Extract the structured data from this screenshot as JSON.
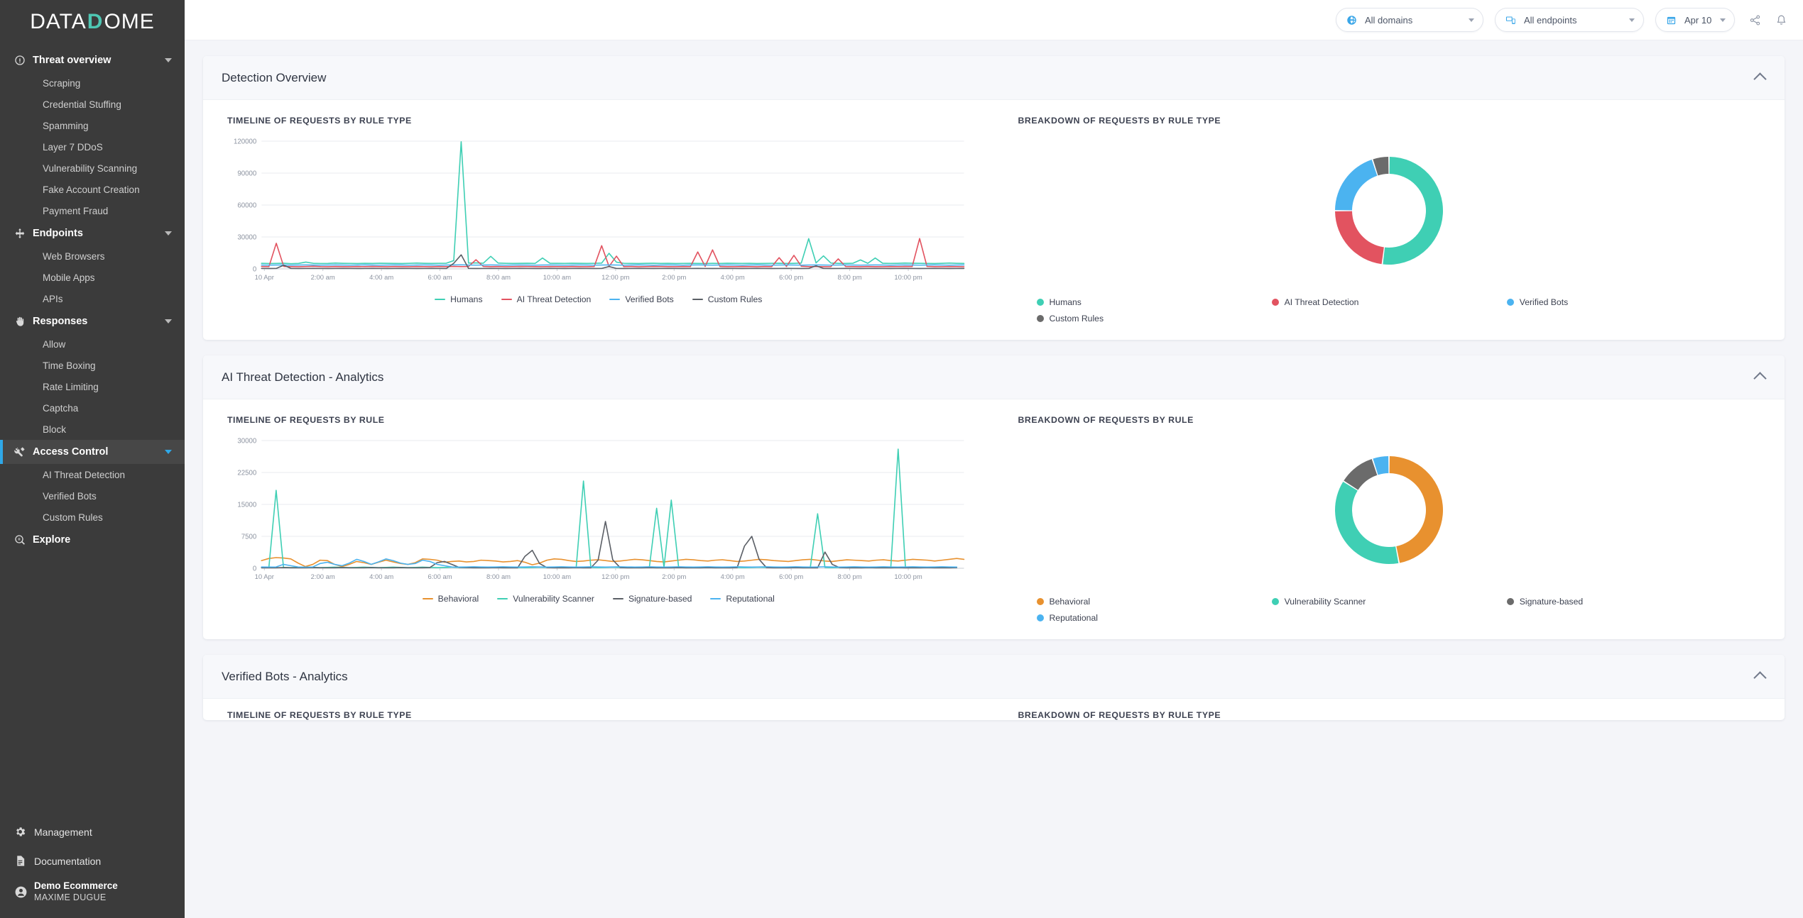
{
  "brand": {
    "name_part1": "DATA",
    "name_d": "D",
    "name_part2": "OME"
  },
  "sidebar": {
    "groups": [
      {
        "label": "Threat overview",
        "icon": "alert-circle-icon",
        "active": false,
        "items": [
          "Scraping",
          "Credential Stuffing",
          "Spamming",
          "Layer 7 DDoS",
          "Vulnerability Scanning",
          "Fake Account Creation",
          "Payment Fraud"
        ]
      },
      {
        "label": "Endpoints",
        "icon": "move-arrows-icon",
        "active": false,
        "items": [
          "Web Browsers",
          "Mobile Apps",
          "APIs"
        ]
      },
      {
        "label": "Responses",
        "icon": "hand-icon",
        "active": false,
        "items": [
          "Allow",
          "Time Boxing",
          "Rate Limiting",
          "Captcha",
          "Block"
        ]
      },
      {
        "label": "Access Control",
        "icon": "tools-icon",
        "active": true,
        "items": [
          "AI Threat Detection",
          "Verified Bots",
          "Custom Rules"
        ]
      },
      {
        "label": "Explore",
        "icon": "explore-icon",
        "active": false,
        "items": []
      }
    ],
    "bottom": [
      {
        "label": "Management",
        "icon": "gear-icon"
      },
      {
        "label": "Documentation",
        "icon": "document-icon"
      }
    ],
    "user": {
      "account": "Demo Ecommerce",
      "name": "MAXIME DUGUE",
      "icon": "user-avatar-icon"
    }
  },
  "topbar": {
    "domains": {
      "label": "All domains",
      "icon": "globe-icon"
    },
    "endpoints": {
      "label": "All endpoints",
      "icon": "devices-icon"
    },
    "date": {
      "label": "Apr 10",
      "icon": "calendar-icon"
    },
    "share_icon": "share-icon",
    "bell_icon": "bell-icon"
  },
  "cards": [
    {
      "title": "Detection Overview",
      "collapse_icon": "chevron-up-icon"
    },
    {
      "title": "AI Threat Detection - Analytics",
      "collapse_icon": "chevron-up-icon"
    },
    {
      "title": "Verified Bots - Analytics",
      "collapse_icon": "chevron-up-icon"
    }
  ],
  "panel_titles": {
    "timeline_rule_type": "TIMELINE OF REQUESTS BY RULE TYPE",
    "breakdown_rule_type": "BREAKDOWN OF REQUESTS BY RULE TYPE",
    "timeline_rule": "TIMELINE OF REQUESTS BY RULE",
    "breakdown_rule": "BREAKDOWN OF REQUESTS BY RULE"
  },
  "colors": {
    "teal": "#3fcfb4",
    "red": "#e25360",
    "blue": "#4bb3f0",
    "dark": "#5b5f66",
    "orange": "#e8912f",
    "gray": "#6b6b6b",
    "accent_blue": "#2fa8e8",
    "sidebar_bg": "#3b3b3b"
  },
  "chart_data": [
    {
      "id": "timeline-rule-type",
      "type": "line",
      "title": "TIMELINE OF REQUESTS BY RULE TYPE",
      "xlabel": "",
      "ylabel": "",
      "ylim": [
        0,
        120000
      ],
      "yticks": [
        0,
        30000,
        60000,
        90000,
        120000
      ],
      "ytick_labels": [
        "0",
        "30000",
        "60000",
        "90000",
        "120000"
      ],
      "xtick_labels": [
        "10 Apr",
        "2:00 am",
        "4:00 am",
        "6:00 am",
        "8:00 am",
        "10:00 am",
        "12:00 pm",
        "2:00 pm",
        "4:00 pm",
        "6:00 pm",
        "8:00 pm",
        "10:00 pm"
      ],
      "grid": true,
      "legend_position": "bottom",
      "series": [
        {
          "name": "Humans",
          "color": "#3fcfb4",
          "values": [
            5200,
            5000,
            5100,
            5300,
            4900,
            5100,
            6400,
            5200,
            5000,
            5100,
            5400,
            5200,
            5100,
            5000,
            5200,
            5100,
            5300,
            5200,
            5100,
            5000,
            5200,
            5400,
            5200,
            5100,
            5200,
            5300,
            7800,
            119500,
            5400,
            5600,
            5300,
            11800,
            5400,
            5200,
            5100,
            5200,
            5300,
            5100,
            10200,
            5300,
            5200,
            5100,
            5300,
            5200,
            5100,
            5200,
            5400,
            14600,
            6300,
            5200,
            5100,
            5000,
            5200,
            5300,
            5100,
            5200,
            5000,
            5100,
            5200,
            5100,
            5000,
            5200,
            5100,
            5300,
            5200,
            5100,
            5200,
            5000,
            5100,
            5200,
            5300,
            5100,
            5200,
            5400,
            28400,
            5600,
            12200,
            5400,
            5200,
            5100,
            5300,
            8400,
            5200,
            10200,
            5300,
            5100,
            5200,
            5400,
            5300,
            5200,
            5100,
            5000,
            5200,
            5400,
            5200,
            5100
          ]
        },
        {
          "name": "AI Threat Detection",
          "color": "#e25360",
          "values": [
            2200,
            2100,
            24100,
            2300,
            2100,
            2000,
            2200,
            2400,
            2100,
            2000,
            2200,
            2100,
            2000,
            2200,
            2100,
            2300,
            2100,
            2000,
            2200,
            2100,
            2000,
            2200,
            2100,
            2000,
            2200,
            2100,
            2300,
            2100,
            2200,
            8600,
            2300,
            2100,
            2200,
            2000,
            2100,
            2300,
            2200,
            2100,
            2000,
            2200,
            2100,
            2000,
            2200,
            2100,
            2000,
            2200,
            21800,
            2300,
            11900,
            2100,
            2200,
            2000,
            2100,
            2300,
            2200,
            2100,
            2000,
            2200,
            2100,
            15900,
            2300,
            17800,
            2200,
            2100,
            2000,
            2200,
            2100,
            2000,
            2200,
            2100,
            10500,
            2300,
            12700,
            2400,
            2100,
            2200,
            2000,
            2100,
            9400,
            2200,
            2100,
            2000,
            2200,
            2100,
            2000,
            2200,
            2100,
            2300,
            2200,
            28500,
            2300,
            2100,
            2000,
            2200,
            2100,
            2000
          ]
        },
        {
          "name": "Verified Bots",
          "color": "#4bb3f0",
          "values": [
            3600,
            3500,
            3600,
            3700,
            3500,
            3600,
            3700,
            3600,
            3500,
            3600,
            3700,
            3600,
            3500,
            3600,
            3700,
            3600,
            3500,
            3600,
            3700,
            3600,
            3500,
            3600,
            3700,
            3600,
            3500,
            3600,
            3700,
            3800,
            3600,
            3500,
            3600,
            3700,
            3600,
            3500,
            3600,
            3700,
            3600,
            3500,
            3600,
            3700,
            3600,
            3500,
            3600,
            3700,
            3600,
            3500,
            3600,
            3700,
            3600,
            3500,
            3600,
            3700,
            3600,
            3500,
            3600,
            3700,
            3600,
            3500,
            3600,
            3700,
            3600,
            3500,
            3600,
            3700,
            3600,
            3500,
            3600,
            3700,
            3600,
            3500,
            3600,
            3700,
            3600,
            3500,
            3600,
            3700,
            3600,
            3500,
            3600,
            3700,
            3600,
            3500,
            3600,
            3700,
            3600,
            3500,
            3600,
            3700,
            3600,
            3500,
            3600,
            3700,
            3600,
            3500,
            3600,
            3700
          ]
        },
        {
          "name": "Custom Rules",
          "color": "#5b5f66",
          "values": [
            400,
            350,
            400,
            3400,
            400,
            350,
            400,
            450,
            400,
            350,
            400,
            450,
            400,
            350,
            400,
            450,
            400,
            350,
            400,
            450,
            400,
            350,
            400,
            450,
            400,
            350,
            5200,
            13200,
            400,
            350,
            400,
            450,
            400,
            350,
            400,
            450,
            400,
            350,
            400,
            450,
            400,
            350,
            400,
            450,
            400,
            350,
            400,
            2200,
            400,
            350,
            400,
            450,
            400,
            350,
            400,
            450,
            400,
            350,
            400,
            450,
            400,
            350,
            400,
            450,
            400,
            350,
            400,
            450,
            400,
            350,
            400,
            450,
            400,
            350,
            400,
            2800,
            400,
            350,
            400,
            450,
            400,
            350,
            400,
            450,
            400,
            350,
            400,
            450,
            400,
            350,
            400,
            450,
            400,
            350,
            400,
            450
          ]
        }
      ]
    },
    {
      "id": "breakdown-rule-type",
      "type": "pie",
      "title": "BREAKDOWN OF REQUESTS BY RULE TYPE",
      "donut": true,
      "legend_position": "bottom",
      "labels": [
        "Humans",
        "AI Threat Detection",
        "Verified Bots",
        "Custom Rules"
      ],
      "values": [
        52,
        23,
        20,
        5
      ],
      "colors": [
        "#3fcfb4",
        "#e25360",
        "#4bb3f0",
        "#6b6b6b"
      ]
    },
    {
      "id": "timeline-rule",
      "type": "line",
      "title": "TIMELINE OF REQUESTS BY RULE",
      "xlabel": "",
      "ylabel": "",
      "ylim": [
        0,
        30000
      ],
      "yticks": [
        0,
        7500,
        15000,
        22500,
        30000
      ],
      "ytick_labels": [
        "0",
        "7500",
        "15000",
        "22500",
        "30000"
      ],
      "xtick_labels": [
        "10 Apr",
        "2:00 am",
        "4:00 am",
        "6:00 am",
        "8:00 am",
        "10:00 am",
        "12:00 pm",
        "2:00 pm",
        "4:00 pm",
        "6:00 pm",
        "8:00 pm",
        "10:00 pm"
      ],
      "grid": true,
      "legend_position": "bottom",
      "series": [
        {
          "name": "Behavioral",
          "color": "#e8912f",
          "values": [
            1800,
            2300,
            2500,
            2400,
            2200,
            1200,
            400,
            900,
            1900,
            1800,
            900,
            400,
            900,
            1600,
            1300,
            900,
            1400,
            1900,
            1500,
            1100,
            900,
            1300,
            2200,
            2100,
            1900,
            1400,
            1600,
            1700,
            1500,
            1600,
            1900,
            1800,
            1700,
            1500,
            1600,
            1800,
            1400,
            800,
            1200,
            1900,
            2200,
            2100,
            1800,
            1600,
            1700,
            1900,
            2000,
            1800,
            1600,
            1700,
            1900,
            2100,
            2000,
            1800,
            1600,
            1500,
            1700,
            1900,
            2100,
            2000,
            1800,
            1700,
            1900,
            2000,
            1800,
            1600,
            1700,
            1900,
            2100,
            2000,
            1800,
            1700,
            1600,
            1800,
            2000,
            2100,
            1900,
            1700,
            1600,
            1800,
            2000,
            1900,
            1800,
            1700,
            1900,
            2000,
            1800,
            1700,
            1900,
            2100,
            2000,
            1900,
            1700,
            1900,
            2100,
            2300,
            2100
          ]
        },
        {
          "name": "Vulnerability Scanner",
          "color": "#3fcfb4",
          "values": [
            200,
            150,
            18300,
            200,
            150,
            200,
            250,
            200,
            150,
            200,
            250,
            200,
            150,
            200,
            250,
            200,
            150,
            200,
            250,
            200,
            150,
            200,
            250,
            200,
            150,
            200,
            250,
            200,
            150,
            200,
            250,
            200,
            150,
            200,
            250,
            200,
            150,
            200,
            250,
            200,
            150,
            200,
            250,
            200,
            20500,
            200,
            150,
            200,
            250,
            200,
            150,
            200,
            250,
            200,
            14100,
            200,
            16000,
            200,
            150,
            200,
            250,
            200,
            150,
            200,
            250,
            200,
            150,
            200,
            250,
            200,
            150,
            200,
            250,
            200,
            150,
            200,
            12800,
            200,
            150,
            200,
            250,
            200,
            150,
            200,
            250,
            200,
            150,
            28000,
            200,
            150,
            200,
            250,
            200,
            150,
            200,
            250
          ]
        },
        {
          "name": "Signature-based",
          "color": "#5b5f66",
          "values": [
            120,
            100,
            120,
            150,
            120,
            100,
            120,
            150,
            120,
            100,
            120,
            150,
            120,
            100,
            120,
            150,
            120,
            100,
            120,
            150,
            120,
            100,
            120,
            150,
            1300,
            1600,
            900,
            200,
            150,
            120,
            100,
            120,
            150,
            120,
            100,
            120,
            2800,
            4200,
            1100,
            150,
            120,
            100,
            120,
            150,
            120,
            100,
            1900,
            11000,
            2000,
            150,
            120,
            100,
            120,
            150,
            120,
            100,
            120,
            150,
            120,
            100,
            120,
            150,
            120,
            100,
            120,
            150,
            5200,
            7500,
            2100,
            150,
            120,
            100,
            120,
            150,
            120,
            100,
            120,
            3800,
            900,
            150,
            120,
            100,
            120,
            150,
            120,
            100,
            120,
            150,
            120,
            100,
            120,
            150,
            120,
            100,
            120,
            150
          ]
        },
        {
          "name": "Reputational",
          "color": "#4bb3f0",
          "values": [
            300,
            280,
            300,
            900,
            600,
            300,
            280,
            300,
            1100,
            1400,
            900,
            600,
            1200,
            2100,
            1600,
            900,
            1500,
            2200,
            1800,
            1200,
            900,
            1100,
            1900,
            1600,
            900,
            600,
            300,
            280,
            300,
            350,
            300,
            280,
            300,
            350,
            300,
            280,
            300,
            350,
            300,
            280,
            300,
            350,
            300,
            280,
            300,
            350,
            300,
            280,
            300,
            350,
            300,
            280,
            300,
            350,
            300,
            280,
            300,
            350,
            300,
            280,
            300,
            350,
            300,
            280,
            300,
            350,
            300,
            280,
            300,
            350,
            300,
            280,
            300,
            350,
            300,
            280,
            300,
            350,
            300,
            280,
            300,
            350,
            300,
            280,
            300,
            350,
            300,
            280,
            300,
            350,
            300,
            280,
            300,
            350,
            300,
            280
          ]
        }
      ]
    },
    {
      "id": "breakdown-rule",
      "type": "pie",
      "title": "BREAKDOWN OF REQUESTS BY RULE",
      "donut": true,
      "legend_position": "bottom",
      "labels": [
        "Behavioral",
        "Vulnerability Scanner",
        "Signature-based",
        "Reputational"
      ],
      "values": [
        47,
        37,
        11,
        5
      ],
      "colors": [
        "#e8912f",
        "#3fcfb4",
        "#6b6b6b",
        "#4bb3f0"
      ]
    }
  ]
}
